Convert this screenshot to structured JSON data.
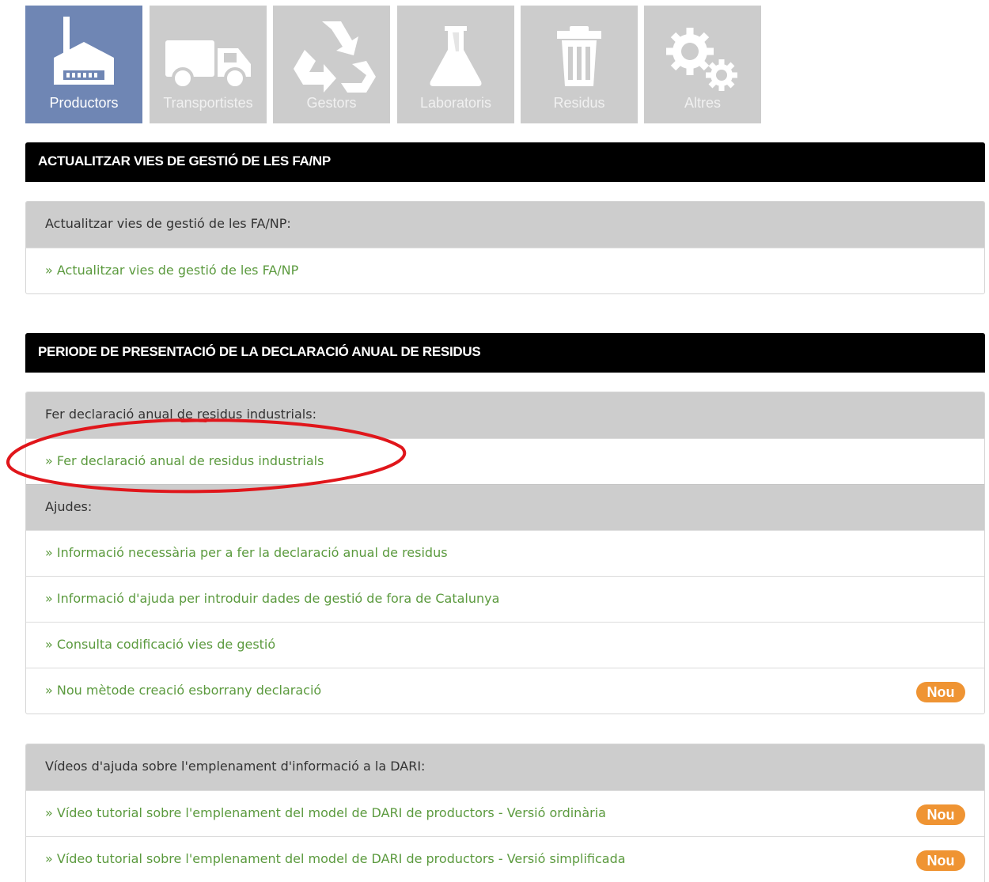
{
  "tabs": [
    {
      "label": "Productors",
      "icon": "factory-icon",
      "active": true
    },
    {
      "label": "Transportistes",
      "icon": "truck-icon",
      "active": false
    },
    {
      "label": "Gestors",
      "icon": "recycle-icon",
      "active": false
    },
    {
      "label": "Laboratoris",
      "icon": "flask-icon",
      "active": false
    },
    {
      "label": "Residus",
      "icon": "trash-icon",
      "active": false
    },
    {
      "label": "Altres",
      "icon": "gears-icon",
      "active": false
    }
  ],
  "sections": {
    "update": {
      "title": "ACTUALITZAR VIES DE GESTIÓ DE LES FA/NP",
      "heading": "Actualitzar vies de gestió de les FA/NP:",
      "link": "» Actualitzar vies de gestió de les FA/NP"
    },
    "declaration": {
      "title": "PERIODE DE PRESENTACIÓ DE LA DECLARACIÓ ANUAL DE RESIDUS",
      "heading": "Fer declaració anual de residus industrials:",
      "link": "» Fer declaració anual de residus industrials",
      "help_heading": "Ajudes:",
      "help_links": [
        "» Informació necessària per a fer la declaració anual de residus",
        "» Informació d'ajuda per introduir dades de gestió de fora de Catalunya",
        "» Consulta codificació vies de gestió",
        "» Nou mètode creació esborrany declaració"
      ]
    },
    "videos": {
      "heading": "Vídeos d'ajuda sobre l'emplenament d'informació a la DARI:",
      "links": [
        "» Vídeo tutorial sobre l'emplenament del model de DARI de productors - Versió ordinària",
        "» Vídeo tutorial sobre l'emplenament del model de DARI de productors - Versió simplificada"
      ]
    }
  },
  "badge_label": "Nou",
  "colors": {
    "active_tab": "#6f86b4",
    "inactive_tab": "#cccccc",
    "link": "#5b9a3e",
    "badge": "#ef9433",
    "annotation": "#e0161b"
  }
}
